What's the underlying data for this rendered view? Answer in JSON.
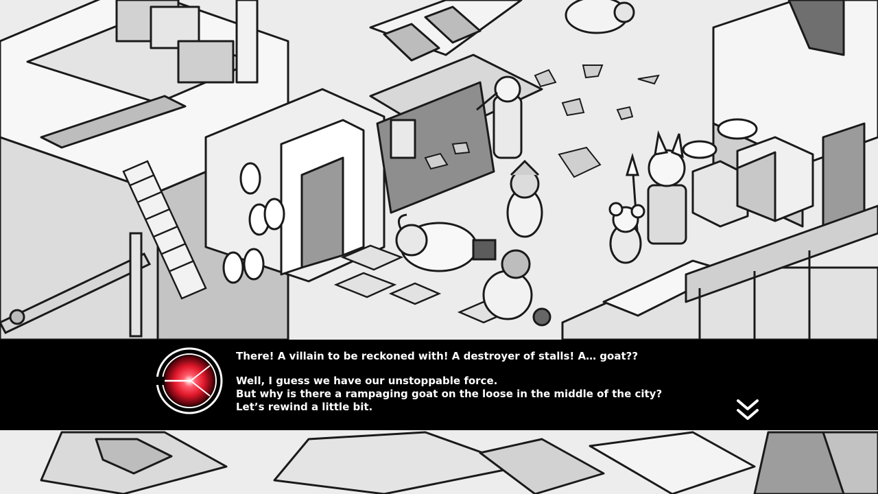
{
  "dialogue": {
    "line1": "There! A villain to be reckoned with! A destroyer of stalls! A… goat??",
    "line2": "Well, I guess we have our unstoppable force.",
    "line3": "But why is there a rampaging goat on the loose in the middle of the city?",
    "line4": "Let’s rewind a little bit."
  },
  "speaker": {
    "icon": "red-glow-orb-icon",
    "accent_color": "#e0182b"
  },
  "advance": {
    "icon": "double-chevron-down-icon"
  },
  "colors": {
    "dialogue_background": "#000000",
    "dialogue_text": "#ffffff",
    "scene_background": "#e9e9e9"
  }
}
